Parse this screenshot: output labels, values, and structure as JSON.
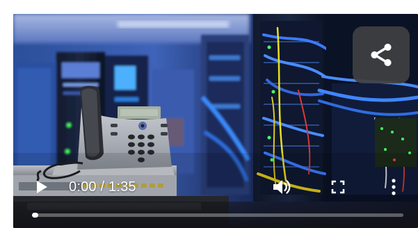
{
  "player": {
    "current_time": "0:00",
    "separator": " / ",
    "duration": "1:35",
    "progress_fraction": 0.0
  },
  "icons": {
    "share": "share-icon",
    "play": "play-icon",
    "volume": "volume-icon",
    "fullscreen": "fullscreen-icon",
    "more": "more-options-icon"
  },
  "colors": {
    "controls_fg": "#ffffff",
    "share_bg": "#404042",
    "progress_track": "#7a7a7a",
    "progress_fill": "#ffffff"
  }
}
